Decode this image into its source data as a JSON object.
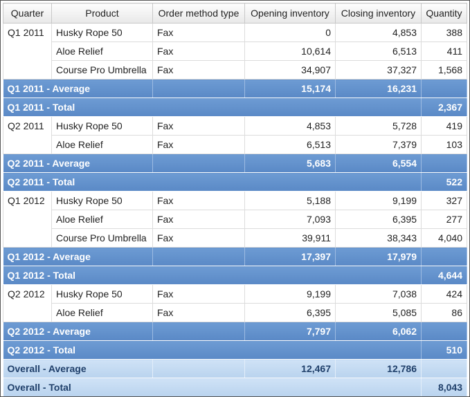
{
  "headers": [
    "Quarter",
    "Product",
    "Order method type",
    "Opening inventory",
    "Closing inventory",
    "Quantity"
  ],
  "groups": [
    {
      "quarter": "Q1 2011",
      "rows": [
        {
          "product": "Husky Rope 50",
          "method": "Fax",
          "opening": "0",
          "closing": "4,853",
          "quantity": "388"
        },
        {
          "product": "Aloe Relief",
          "method": "Fax",
          "opening": "10,614",
          "closing": "6,513",
          "quantity": "411"
        },
        {
          "product": "Course Pro Umbrella",
          "method": "Fax",
          "opening": "34,907",
          "closing": "37,327",
          "quantity": "1,568"
        }
      ],
      "average": {
        "label": "Q1 2011 - Average",
        "opening": "15,174",
        "closing": "16,231"
      },
      "total": {
        "label": "Q1 2011 - Total",
        "quantity": "2,367"
      }
    },
    {
      "quarter": "Q2 2011",
      "rows": [
        {
          "product": "Husky Rope 50",
          "method": "Fax",
          "opening": "4,853",
          "closing": "5,728",
          "quantity": "419"
        },
        {
          "product": "Aloe Relief",
          "method": "Fax",
          "opening": "6,513",
          "closing": "7,379",
          "quantity": "103"
        }
      ],
      "average": {
        "label": "Q2 2011 - Average",
        "opening": "5,683",
        "closing": "6,554"
      },
      "total": {
        "label": "Q2 2011 - Total",
        "quantity": "522"
      }
    },
    {
      "quarter": "Q1 2012",
      "rows": [
        {
          "product": "Husky Rope 50",
          "method": "Fax",
          "opening": "5,188",
          "closing": "9,199",
          "quantity": "327"
        },
        {
          "product": "Aloe Relief",
          "method": "Fax",
          "opening": "7,093",
          "closing": "6,395",
          "quantity": "277"
        },
        {
          "product": "Course Pro Umbrella",
          "method": "Fax",
          "opening": "39,911",
          "closing": "38,343",
          "quantity": "4,040"
        }
      ],
      "average": {
        "label": "Q1 2012 - Average",
        "opening": "17,397",
        "closing": "17,979"
      },
      "total": {
        "label": "Q1 2012 - Total",
        "quantity": "4,644"
      }
    },
    {
      "quarter": "Q2 2012",
      "rows": [
        {
          "product": "Husky Rope 50",
          "method": "Fax",
          "opening": "9,199",
          "closing": "7,038",
          "quantity": "424"
        },
        {
          "product": "Aloe Relief",
          "method": "Fax",
          "opening": "6,395",
          "closing": "5,085",
          "quantity": "86"
        }
      ],
      "average": {
        "label": "Q2 2012 - Average",
        "opening": "7,797",
        "closing": "6,062"
      },
      "total": {
        "label": "Q2 2012 - Total",
        "quantity": "510"
      }
    }
  ],
  "overall": {
    "average": {
      "label": "Overall - Average",
      "opening": "12,467",
      "closing": "12,786"
    },
    "total": {
      "label": "Overall - Total",
      "quantity": "8,043"
    }
  },
  "colors": {
    "subtotal_band": "#6d9bd3",
    "overall_band": "#c5dbf2",
    "header_bg": "#efefef"
  }
}
